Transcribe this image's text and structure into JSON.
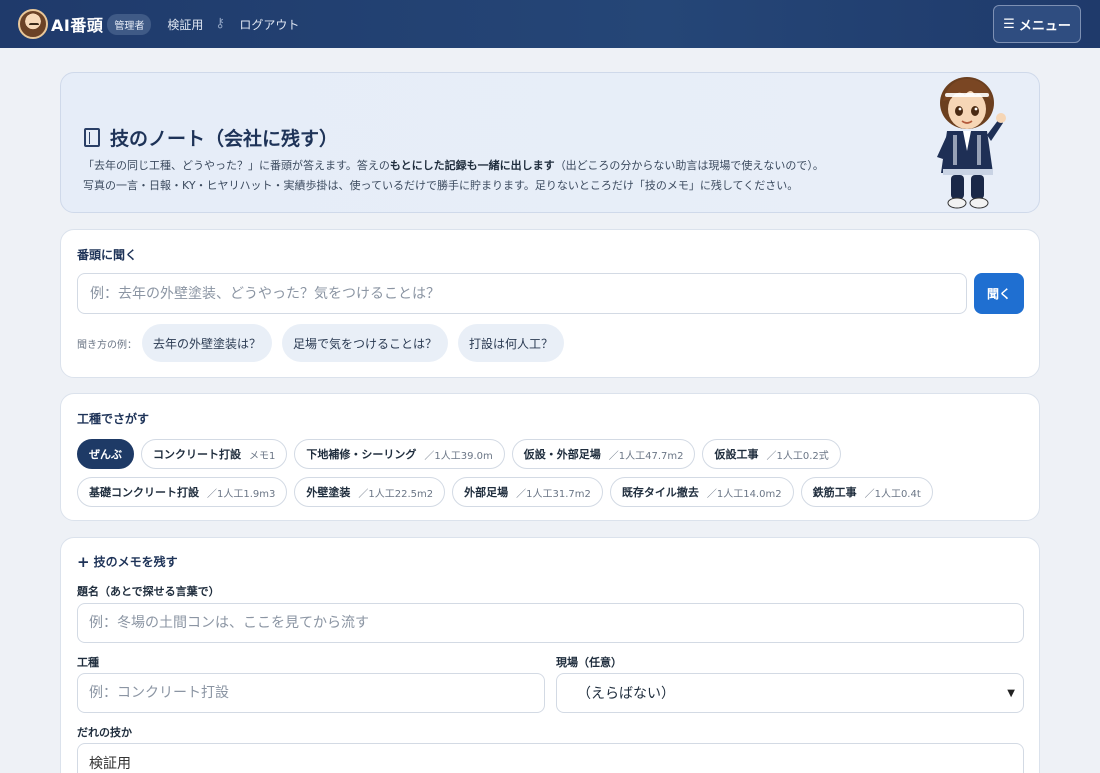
{
  "header": {
    "brand": "AI番頭",
    "role_badge": "管理者",
    "nav_verify": "検証用",
    "nav_logout": "ログアウト",
    "menu_label": "メニュー"
  },
  "hero": {
    "title": "技のノート（会社に残す）",
    "line1_a": "「去年の同じ工種、どうやった？」に番頭が答えます。答えの",
    "line1_b": "もとにした記録も一緒に出します",
    "line1_c": "（出どころの分からない助言は現場で使えないので）。",
    "line2": "写真の一言・日報・KY・ヒヤリハット・実績歩掛は、使っているだけで勝手に貯まります。足りないところだけ「技のメモ」に残してください。"
  },
  "ask": {
    "label": "番頭に聞く",
    "placeholder": "例：去年の外壁塗装、どうやった？気をつけることは？",
    "button": "聞く",
    "examples_label": "聞き方の例：",
    "examples": [
      "去年の外壁塗装は？",
      "足場で気をつけることは？",
      "打設は何人工？"
    ]
  },
  "categories": {
    "label": "工種でさがす",
    "row1": [
      {
        "name": "ぜんぶ",
        "meta": ""
      },
      {
        "name": "コンクリート打設",
        "meta": "メモ1"
      },
      {
        "name": "下地補修・シーリング",
        "meta": "／1人工39.0m"
      },
      {
        "name": "仮設・外部足場",
        "meta": "／1人工47.7m2"
      },
      {
        "name": "仮設工事",
        "meta": "／1人工0.2式"
      }
    ],
    "row2": [
      {
        "name": "基礎コンクリート打設",
        "meta": "／1人工1.9m3"
      },
      {
        "name": "外壁塗装",
        "meta": "／1人工22.5m2"
      },
      {
        "name": "外部足場",
        "meta": "／1人工31.7m2"
      },
      {
        "name": "既存タイル撤去",
        "meta": "／1人工14.0m2"
      },
      {
        "name": "鉄筋工事",
        "meta": "／1人工0.4t"
      }
    ]
  },
  "memo": {
    "heading": "技のメモを残す",
    "title_label": "題名（あとで探せる言葉で）",
    "title_placeholder": "例：冬場の土間コンは、ここを見てから流す",
    "work_label": "工種",
    "work_placeholder": "例：コンクリート打設",
    "site_label": "現場（任意）",
    "site_value": "（えらばない）",
    "who_label": "だれの技か",
    "who_value": "検証用"
  },
  "colors": {
    "nav_bg": "#1f3a6b",
    "accent_button": "#1f6fd1",
    "active_chip": "#1e3a66"
  },
  "icons": {
    "menu": "hamburger-icon",
    "key": "key-icon",
    "book": "book-icon",
    "plus": "plus-icon",
    "caret": "chevron-down-icon"
  }
}
